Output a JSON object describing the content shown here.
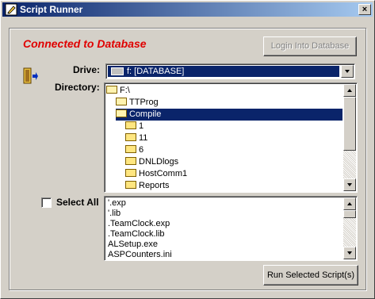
{
  "window": {
    "title": "Script Runner",
    "app_icon": "pencil-icon",
    "close_icon": "close-icon",
    "close_glyph": "×"
  },
  "status": {
    "text": "Connected to Database",
    "color": "#e00000"
  },
  "login_button": {
    "label": "Login Into Database",
    "enabled": false
  },
  "side_icon": "exit-door-icon",
  "drive": {
    "label": "Drive:",
    "value": "f: [DATABASE]"
  },
  "directory": {
    "label": "Directory:",
    "items": [
      {
        "name": "F:\\",
        "indent": 0,
        "open": true,
        "selected": false
      },
      {
        "name": "TTProg",
        "indent": 1,
        "open": true,
        "selected": false
      },
      {
        "name": "Compile",
        "indent": 1,
        "open": true,
        "selected": true
      },
      {
        "name": "1",
        "indent": 2,
        "open": false,
        "selected": false
      },
      {
        "name": "11",
        "indent": 2,
        "open": false,
        "selected": false
      },
      {
        "name": "6",
        "indent": 2,
        "open": false,
        "selected": false
      },
      {
        "name": "DNLDlogs",
        "indent": 2,
        "open": false,
        "selected": false
      },
      {
        "name": "HostComm1",
        "indent": 2,
        "open": false,
        "selected": false
      },
      {
        "name": "Reports",
        "indent": 2,
        "open": false,
        "selected": false
      }
    ]
  },
  "select_all": {
    "label": "Select All",
    "checked": false
  },
  "files": [
    "'.exp",
    "'.lib",
    ".TeamClock.exp",
    ".TeamClock.lib",
    "ALSetup.exe",
    "ASPCounters.ini"
  ],
  "run_button": {
    "label": "Run Selected Script(s)"
  },
  "colors": {
    "face": "#d4d0c8",
    "title_start": "#0a246a",
    "title_end": "#a6caf0",
    "highlight": "#0a246a"
  }
}
